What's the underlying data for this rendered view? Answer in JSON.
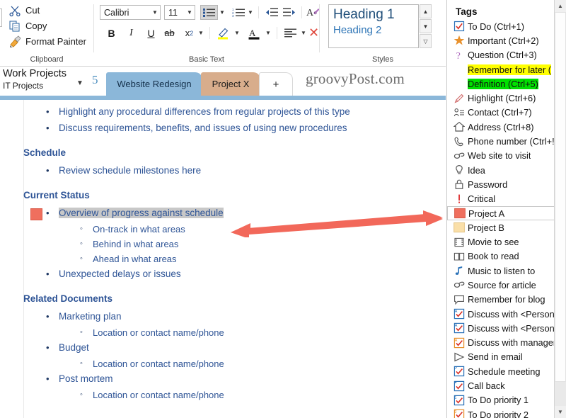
{
  "ribbon": {
    "clipboard": {
      "group_label": "Clipboard",
      "items": [
        {
          "label": "Cut",
          "icon": "scissors-icon"
        },
        {
          "label": "Copy",
          "icon": "copy-icon"
        },
        {
          "label": "Format Painter",
          "icon": "paintbrush-icon"
        }
      ]
    },
    "basic_text": {
      "group_label": "Basic Text",
      "font_name": "Calibri",
      "font_size": "11",
      "buttons": [
        {
          "name": "bullets",
          "glyph": "≡"
        },
        {
          "name": "numbering",
          "glyph": "≡"
        },
        {
          "name": "decrease-indent",
          "glyph": "⇤"
        },
        {
          "name": "increase-indent",
          "glyph": "⇥"
        },
        {
          "name": "clear-formatting",
          "glyph": "A"
        },
        {
          "name": "bold",
          "glyph": "B"
        },
        {
          "name": "italic",
          "glyph": "I"
        },
        {
          "name": "underline",
          "glyph": "U"
        },
        {
          "name": "strikethrough",
          "glyph": "ab"
        },
        {
          "name": "subscript",
          "glyph": "x₂"
        },
        {
          "name": "text-highlight",
          "glyph": "✐"
        },
        {
          "name": "font-color",
          "glyph": "A"
        },
        {
          "name": "align",
          "glyph": "≡"
        },
        {
          "name": "remove-tag",
          "glyph": "×"
        }
      ]
    },
    "styles": {
      "group_label": "Styles",
      "heading1": "Heading 1",
      "heading2": "Heading 2"
    }
  },
  "notebook": {
    "name": "Work Projects",
    "section_group": "IT Projects",
    "page_count": "5",
    "tabs": [
      {
        "label": "Website Redesign",
        "state": "selected"
      },
      {
        "label": "Project X",
        "state": "alt"
      },
      {
        "label": "+",
        "state": "add"
      }
    ]
  },
  "watermark": "groovyPost.com",
  "page": {
    "lines": [
      {
        "text": "Highlight any procedural differences from regular projects of this type",
        "level": 1,
        "type": "bullet"
      },
      {
        "text": "Discuss requirements, benefits, and issues of using new procedures",
        "level": 1,
        "type": "bullet"
      },
      {
        "text": "Schedule",
        "level": 0,
        "type": "heading"
      },
      {
        "text": "Review schedule milestones here",
        "level": 1,
        "type": "bullet"
      },
      {
        "text": "Current Status",
        "level": 0,
        "type": "heading"
      },
      {
        "text": "Overview of progress against schedule",
        "level": 1,
        "type": "bullet",
        "tagged": true,
        "selected": true
      },
      {
        "text": "On-track in what areas",
        "level": 2,
        "type": "hollow"
      },
      {
        "text": "Behind in what areas",
        "level": 2,
        "type": "hollow"
      },
      {
        "text": "Ahead in what areas",
        "level": 2,
        "type": "hollow"
      },
      {
        "text": "Unexpected delays or issues",
        "level": 1,
        "type": "bullet"
      },
      {
        "text": "Related Documents",
        "level": 0,
        "type": "heading"
      },
      {
        "text": "Marketing plan",
        "level": 1,
        "type": "bullet"
      },
      {
        "text": "Location or contact name/phone",
        "level": 2,
        "type": "hollow"
      },
      {
        "text": "Budget",
        "level": 1,
        "type": "bullet"
      },
      {
        "text": "Location or contact name/phone",
        "level": 2,
        "type": "hollow"
      },
      {
        "text": "Post mortem",
        "level": 1,
        "type": "bullet"
      },
      {
        "text": "Location or contact name/phone",
        "level": 2,
        "type": "hollow"
      }
    ],
    "tag_color": "#ef6f5e",
    "text_color": "#2e5496",
    "heading_color": "#1f3864"
  },
  "annotation": {
    "arrow_color": "#f2685a",
    "arrow_type": "double-headed-arrow"
  },
  "tags_pane": {
    "title": "Tags",
    "items": [
      {
        "label": "To Do (Ctrl+1)",
        "icon": "checkbox-blue-icon"
      },
      {
        "label": "Important (Ctrl+2)",
        "icon": "star-icon"
      },
      {
        "label": "Question (Ctrl+3)",
        "icon": "question-mark-icon"
      },
      {
        "label": "Remember for later (",
        "icon": "none",
        "highlight": "yellow"
      },
      {
        "label": "Definition (Ctrl+5)",
        "icon": "none",
        "highlight": "green"
      },
      {
        "label": "Highlight (Ctrl+6)",
        "icon": "pencil-icon"
      },
      {
        "label": "Contact (Ctrl+7)",
        "icon": "contact-icon"
      },
      {
        "label": "Address (Ctrl+8)",
        "icon": "home-icon"
      },
      {
        "label": "Phone number (Ctrl+!",
        "icon": "phone-icon"
      },
      {
        "label": "Web site to visit",
        "icon": "link-icon"
      },
      {
        "label": "Idea",
        "icon": "lightbulb-icon"
      },
      {
        "label": "Password",
        "icon": "lock-icon"
      },
      {
        "label": "Critical",
        "icon": "exclamation-icon"
      },
      {
        "label": "Project A",
        "icon": "red-square-icon",
        "selected": true
      },
      {
        "label": "Project B",
        "icon": "tan-square-icon"
      },
      {
        "label": "Movie to see",
        "icon": "film-icon"
      },
      {
        "label": "Book to read",
        "icon": "book-icon"
      },
      {
        "label": "Music to listen to",
        "icon": "music-note-icon"
      },
      {
        "label": "Source for article",
        "icon": "link-icon"
      },
      {
        "label": "Remember for blog",
        "icon": "speech-bubble-icon"
      },
      {
        "label": "Discuss with <Person",
        "icon": "person-checkbox-icon"
      },
      {
        "label": "Discuss with <Person",
        "icon": "person-checkbox-icon"
      },
      {
        "label": "Discuss with manager",
        "icon": "person-checkbox-orange-icon"
      },
      {
        "label": "Send in email",
        "icon": "send-arrow-icon"
      },
      {
        "label": "Schedule meeting",
        "icon": "calendar-checkbox-icon"
      },
      {
        "label": "Call back",
        "icon": "callback-checkbox-icon"
      },
      {
        "label": "To Do priority 1",
        "icon": "priority1-checkbox-icon"
      },
      {
        "label": "To Do priority 2",
        "icon": "priority2-checkbox-icon"
      }
    ],
    "scrollbar": {
      "up": "▲",
      "down": "▼"
    }
  }
}
